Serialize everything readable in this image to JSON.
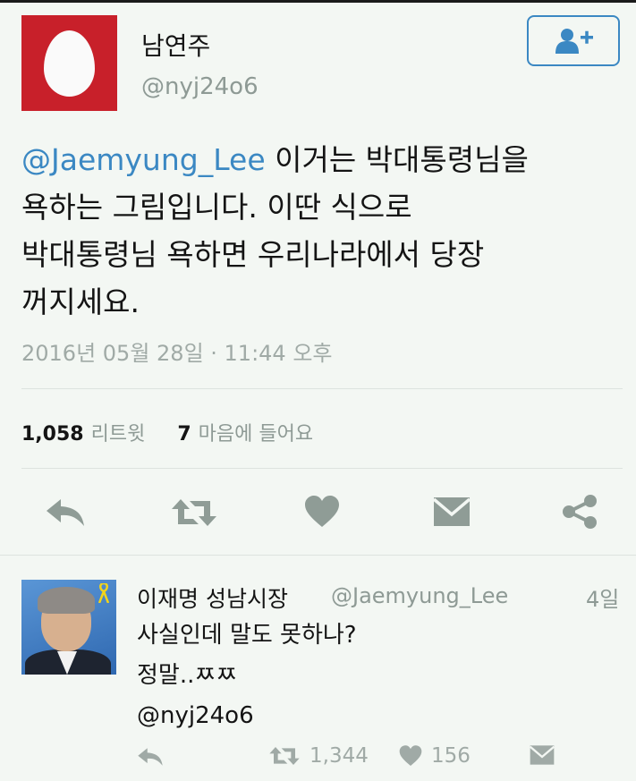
{
  "tweet": {
    "display_name": "남연주",
    "handle": "@nyj24o6",
    "mention": "@Jaemyung_Lee",
    "text_lines": [
      " 이거는 박대통령님을",
      "욕하는 그림입니다. 이딴 식으로",
      "박대통령님 욕하면 우리나라에서 당장",
      "꺼지세요."
    ],
    "timestamp": "2016년 05월 28일 · 11:44 오후",
    "retweet_count": "1,058",
    "retweet_label": "리트윗",
    "like_count": "7",
    "like_label": "마음에 들어요"
  },
  "icons": {
    "follow": "add-user-icon",
    "reply": "reply-icon",
    "retweet": "retweet-icon",
    "like": "heart-icon",
    "dm": "envelope-icon",
    "share": "share-icon"
  },
  "reply": {
    "display_name": "이재명 성남시장",
    "handle": "@Jaemyung_Lee",
    "time": "4일",
    "lines": [
      "사실인데 말도 못하나?",
      "정말..ㅉㅉ",
      "@nyj24o6"
    ],
    "retweet_count": "1,344",
    "like_count": "156"
  },
  "colors": {
    "accent": "#3b88c3",
    "icon_gray": "#8f9c96",
    "avatar_red": "#c8202a",
    "background": "#f3f7f3"
  }
}
